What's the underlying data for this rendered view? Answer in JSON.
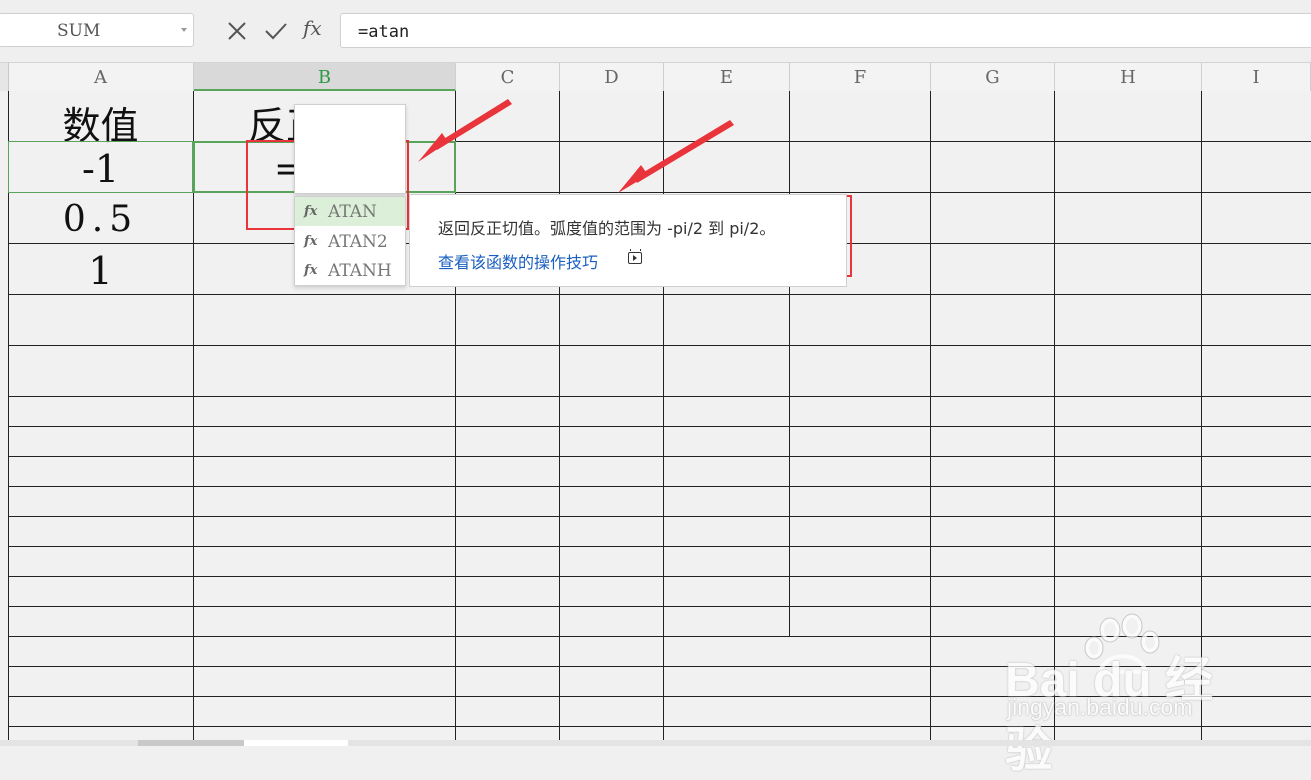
{
  "formula_bar": {
    "name_box": "SUM",
    "cancel_icon": "close-icon",
    "confirm_icon": "check-icon",
    "fx_label": "fx",
    "formula": "=atan"
  },
  "columns": [
    "A",
    "B",
    "C",
    "D",
    "E",
    "F",
    "G",
    "H",
    "I"
  ],
  "active_column": "B",
  "cells": {
    "a1": "数值",
    "b1": "反正切值",
    "a2": "-1",
    "a3": "0.5",
    "a4": "1",
    "b2_editing": "=atan"
  },
  "autocomplete": {
    "icon_label": "fx",
    "items": [
      "ATAN",
      "ATAN2",
      "ATANH"
    ],
    "selected": "ATAN"
  },
  "tooltip": {
    "description": "返回反正切值。弧度值的范围为 -pi/2 到 pi/2。",
    "link": "查看该函数的操作技巧",
    "link_icon": "video-icon"
  },
  "colors": {
    "annotation": "#e8343a",
    "selection": "#5aa35a",
    "link": "#1a5fc1"
  },
  "watermark": {
    "logo_text": "Bai du 经验",
    "url": "jingyan.baidu.com"
  }
}
